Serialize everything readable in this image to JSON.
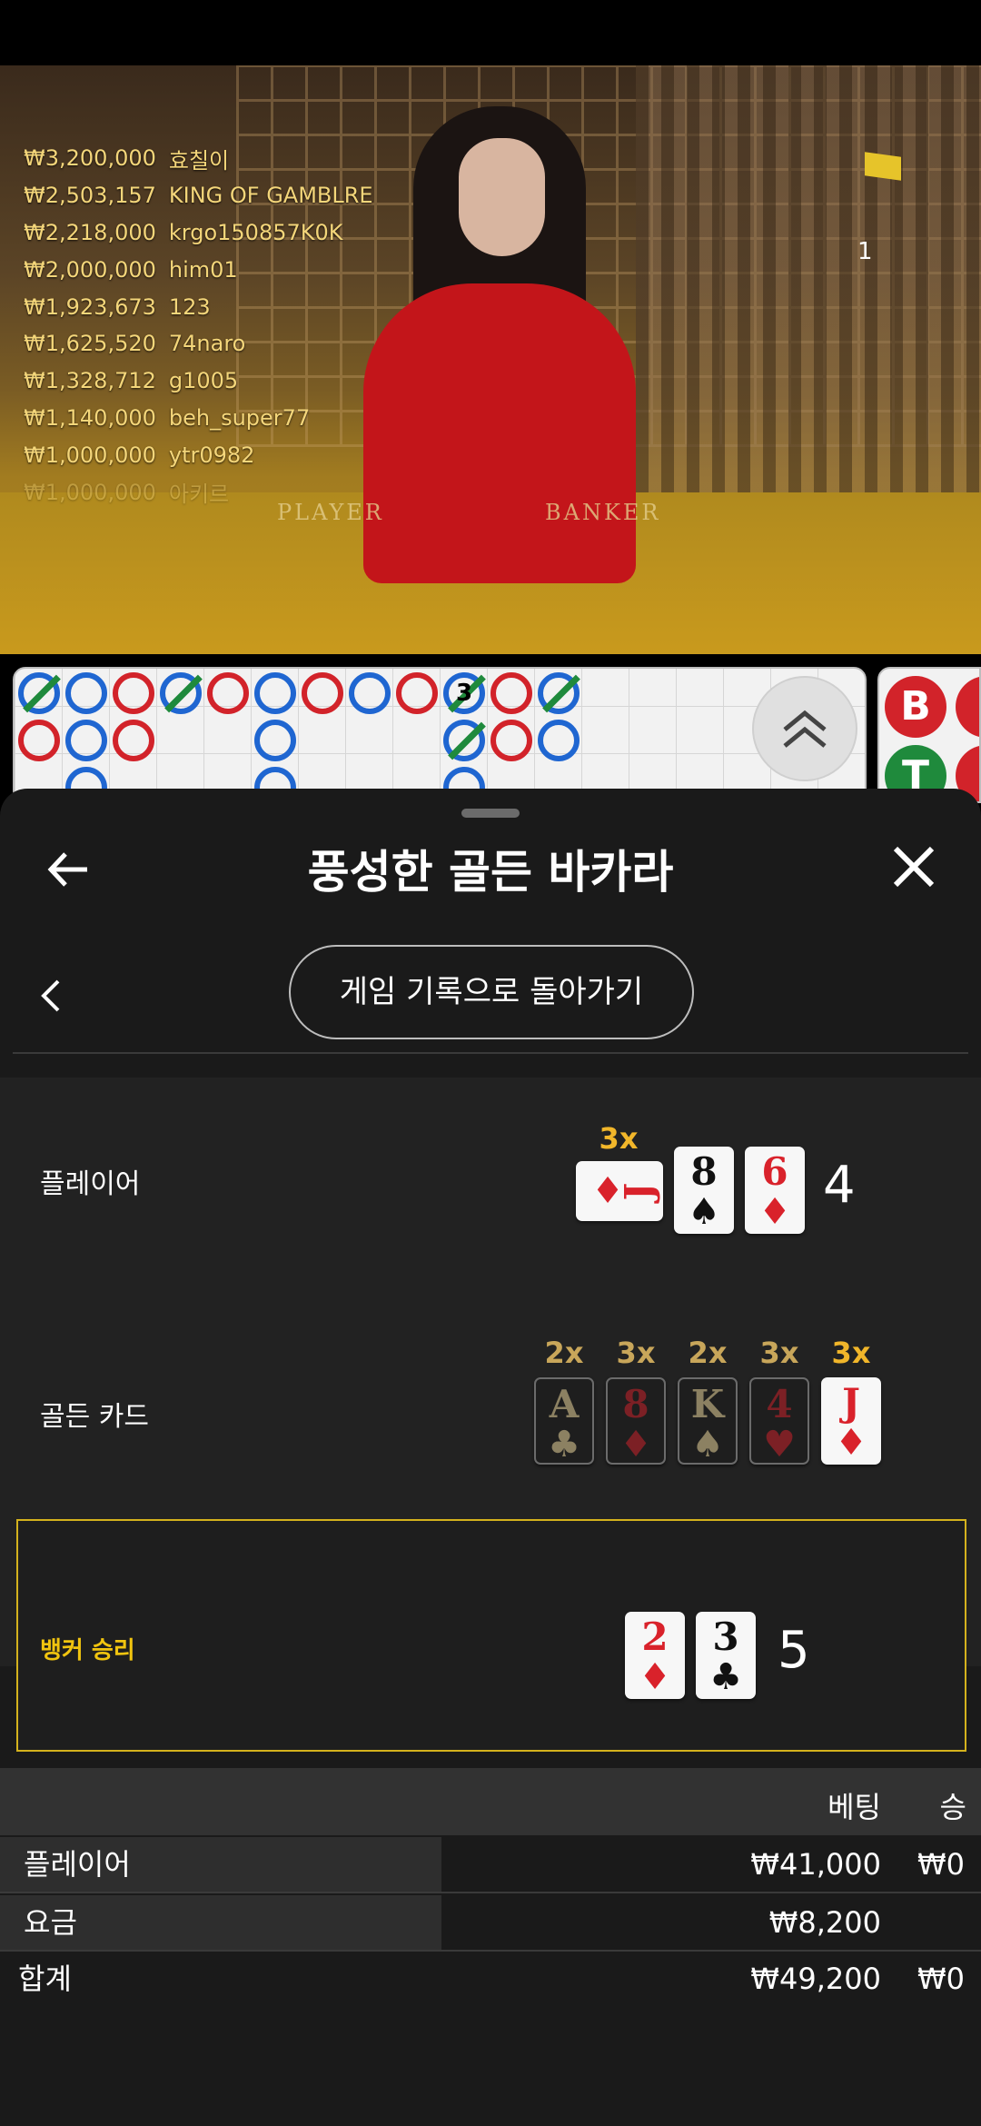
{
  "video": {
    "round_number": "1",
    "table_labels": {
      "player": "PLAYER",
      "banker": "BANKER"
    },
    "leaderboard": [
      {
        "amount": "₩3,200,000",
        "name": "효칠이"
      },
      {
        "amount": "₩2,503,157",
        "name": "KING OF GAMBLRE"
      },
      {
        "amount": "₩2,218,000",
        "name": "krgo150857K0K"
      },
      {
        "amount": "₩2,000,000",
        "name": "him01"
      },
      {
        "amount": "₩1,923,673",
        "name": "123"
      },
      {
        "amount": "₩1,625,520",
        "name": "74naro"
      },
      {
        "amount": "₩1,328,712",
        "name": "g1005"
      },
      {
        "amount": "₩1,140,000",
        "name": "beh_super77"
      },
      {
        "amount": "₩1,000,000",
        "name": "ytr0982"
      },
      {
        "amount": "₩1,000,000",
        "name": "아키르"
      }
    ]
  },
  "roadmap": {
    "bead_number": "3",
    "mini_buttons": {
      "banker": "B",
      "tie": "T"
    },
    "colors": {
      "player": "#1f66d1",
      "banker": "#d2232a",
      "tie": "#1f8a3c"
    }
  },
  "sheet": {
    "title": "풍성한 골든 바카라",
    "back_to_history": "게임 기록으로 돌아가기",
    "player": {
      "label": "플레이어",
      "total": "4",
      "cards": [
        {
          "rank": "J",
          "suit": "♦",
          "color": "red",
          "multiplier": "3x",
          "sideways": true
        },
        {
          "rank": "8",
          "suit": "♠",
          "color": "black"
        },
        {
          "rank": "6",
          "suit": "♦",
          "color": "red"
        }
      ]
    },
    "golden": {
      "label": "골든 카드",
      "cards": [
        {
          "rank": "A",
          "suit": "♣",
          "color": "black",
          "multiplier": "2x"
        },
        {
          "rank": "8",
          "suit": "♦",
          "color": "red",
          "multiplier": "3x"
        },
        {
          "rank": "K",
          "suit": "♠",
          "color": "black",
          "multiplier": "2x"
        },
        {
          "rank": "4",
          "suit": "♥",
          "color": "red",
          "multiplier": "3x"
        },
        {
          "rank": "J",
          "suit": "♦",
          "color": "red",
          "multiplier": "3x",
          "highlighted": true
        }
      ]
    },
    "banker": {
      "label": "뱅커 승리",
      "total": "5",
      "cards": [
        {
          "rank": "2",
          "suit": "♦",
          "color": "red"
        },
        {
          "rank": "3",
          "suit": "♣",
          "color": "black"
        }
      ]
    },
    "bets": {
      "col_bet": "베팅",
      "col_win": "승",
      "rows": [
        {
          "label": "플레이어",
          "bet": "₩41,000",
          "win": "₩0"
        },
        {
          "label": "요금",
          "bet": "₩8,200",
          "win": ""
        }
      ],
      "total": {
        "label": "합계",
        "bet": "₩49,200",
        "win": "₩0"
      }
    },
    "accent_color": "#d4b21d"
  }
}
